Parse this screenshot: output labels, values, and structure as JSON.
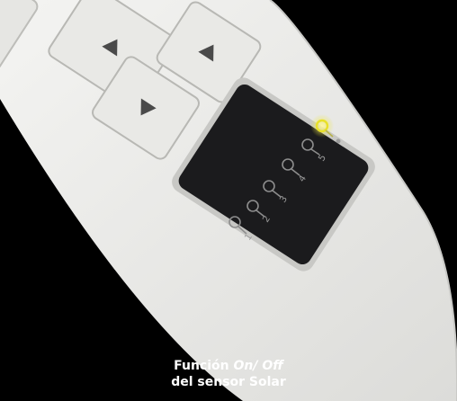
{
  "caption": {
    "line1_prefix": "Función",
    "line1_emphasis": "On/ Off",
    "line2": "del sensor Solar"
  },
  "display": {
    "channel_labels": [
      "1",
      "2",
      "3",
      "4",
      "5"
    ],
    "active_indicator_color": "#e8e02a"
  },
  "colors": {
    "background": "#000000",
    "remote_body": "#ececea",
    "panel": "#1b1b1d",
    "caption_text": "#ffffff"
  }
}
